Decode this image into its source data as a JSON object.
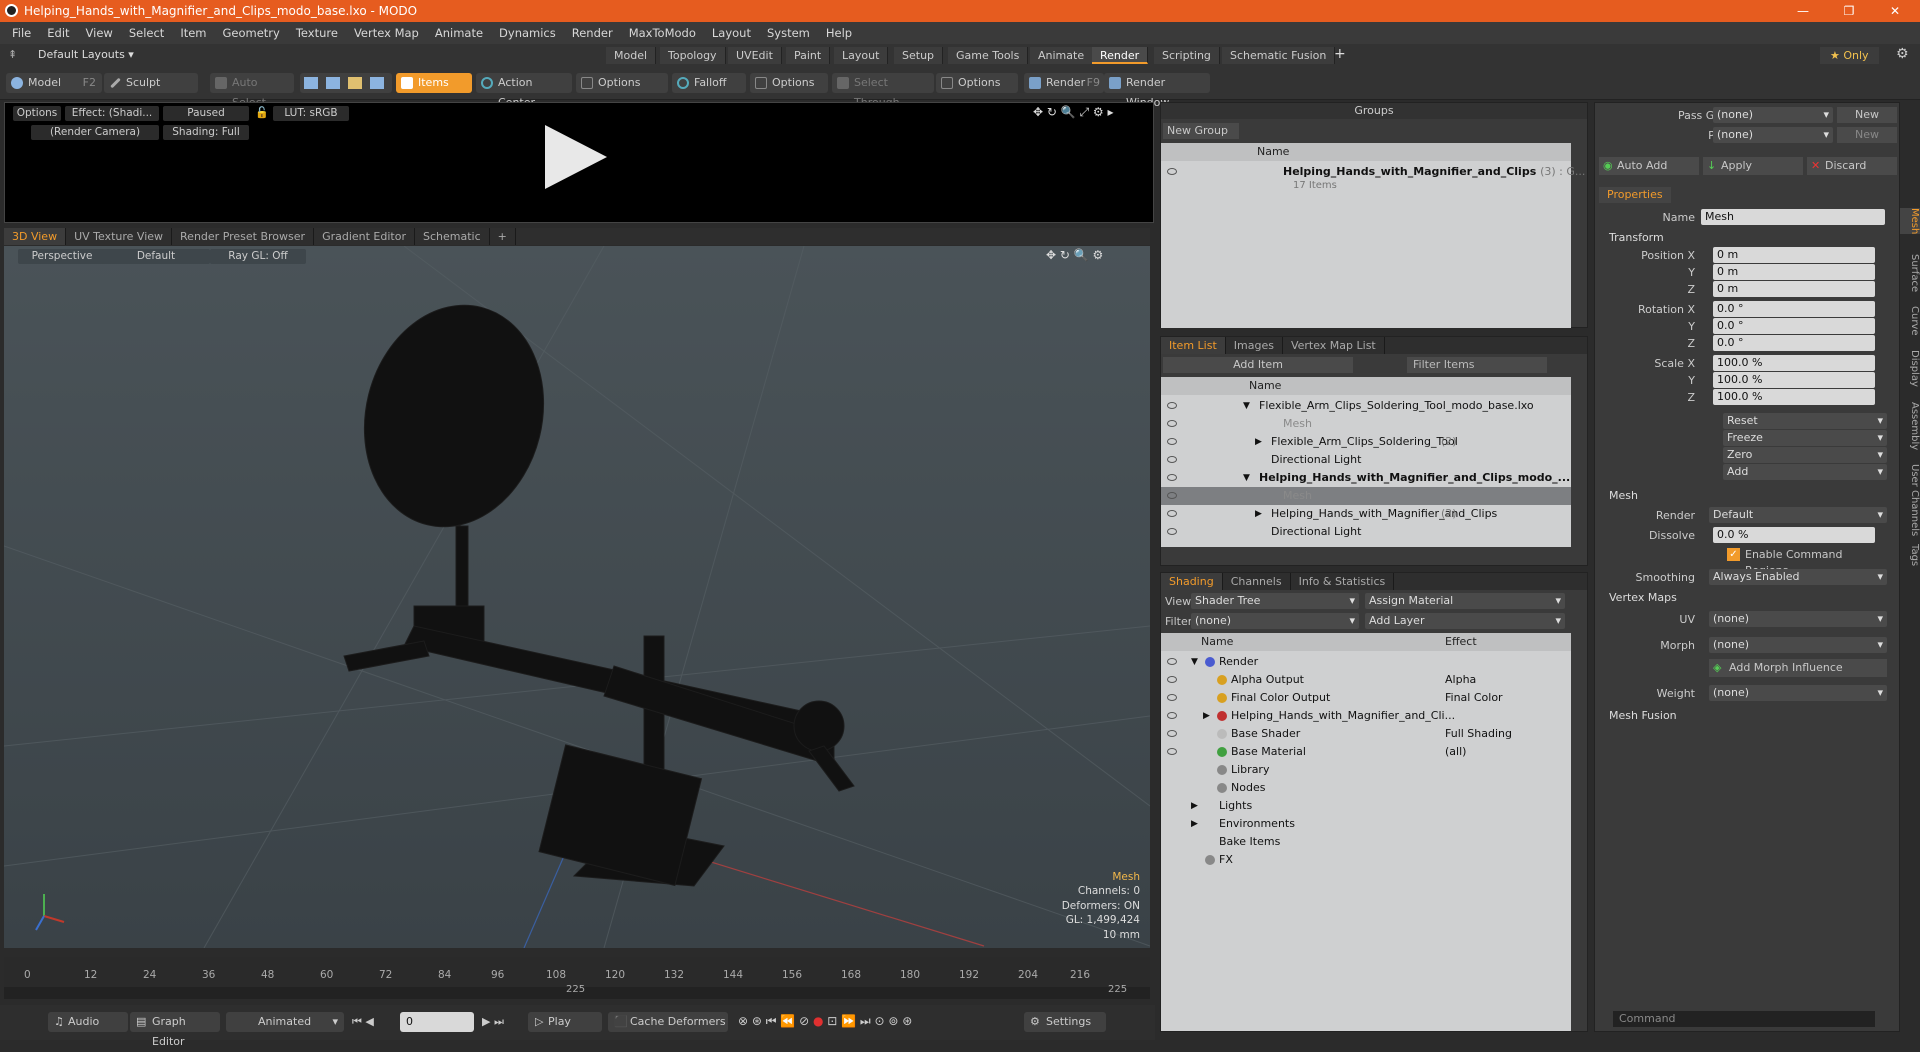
{
  "window": {
    "title": "Helping_Hands_with_Magnifier_and_Clips_modo_base.lxo - MODO",
    "min": "—",
    "max": "❐",
    "close": "✕"
  },
  "menu": [
    "File",
    "Edit",
    "View",
    "Select",
    "Item",
    "Geometry",
    "Texture",
    "Vertex Map",
    "Animate",
    "Dynamics",
    "Render",
    "MaxToModo",
    "Layout",
    "System",
    "Help"
  ],
  "layouts": {
    "default_label": "Default Layouts ▾",
    "tabs": [
      "Model",
      "Topology",
      "UVEdit",
      "Paint",
      "Layout",
      "Setup",
      "Game Tools",
      "Animate",
      "Render",
      "Scripting",
      "Schematic Fusion"
    ],
    "active": "Render",
    "only": "★ Only"
  },
  "toolbar": {
    "model": "Model",
    "model_key": "F2",
    "sculpt": "Sculpt",
    "auto_select": "Auto Select",
    "items": "Items",
    "action_center": "Action Center",
    "options1": "Options",
    "falloff": "Falloff",
    "options2": "Options",
    "select_through": "Select Through",
    "options3": "Options",
    "render": "Render",
    "render_key": "F9",
    "render_window": "Render Window"
  },
  "render_view": {
    "options": "Options",
    "effect": "Effect: (Shadi...",
    "paused": "Paused",
    "lut": "LUT: sRGB",
    "camera": "(Render Camera)",
    "shading": "Shading: Full"
  },
  "view_tabs": [
    "3D View",
    "UV Texture View",
    "Render Preset Browser",
    "Gradient Editor",
    "Schematic"
  ],
  "viewport": {
    "perspective": "Perspective",
    "default": "Default",
    "raygl": "Ray GL: Off",
    "stats_title": "Mesh",
    "channels": "Channels: 0",
    "deformers": "Deformers: ON",
    "gl": "GL: 1,499,424",
    "scale": "10 mm"
  },
  "timeline": {
    "ticks": [
      "0",
      "12",
      "24",
      "36",
      "48",
      "60",
      "72",
      "84",
      "96",
      "108",
      "120",
      "132",
      "144",
      "156",
      "168",
      "180",
      "192",
      "204",
      "216"
    ],
    "mid": "225",
    "end": "225"
  },
  "bottombar": {
    "audio": "Audio",
    "graph_editor": "Graph Editor",
    "animated": "Animated",
    "frame": "0",
    "play": "Play",
    "cache": "Cache Deformers",
    "settings": "Settings"
  },
  "groups": {
    "title": "Groups",
    "new_group": "New Group",
    "col_name": "Name",
    "item_name": "Helping_Hands_with_Magnifier_and_Clips",
    "item_suffix": "(3) : G...",
    "item_count": "17 Items"
  },
  "itemlist": {
    "tabs": [
      "Item List",
      "Images",
      "Vertex Map List"
    ],
    "add_item": "Add Item",
    "filter": "Filter Items",
    "col_name": "Name",
    "rows": [
      {
        "label": "Flexible_Arm_Clips_Soldering_Tool_modo_base.lxo",
        "indent": 0,
        "bold": false,
        "dim": false,
        "sel": false,
        "tri": "▼"
      },
      {
        "label": "Mesh",
        "indent": 2,
        "bold": false,
        "dim": true,
        "sel": false,
        "tri": ""
      },
      {
        "label": "Flexible_Arm_Clips_Soldering_Tool",
        "count": "(2)",
        "indent": 1,
        "bold": false,
        "dim": false,
        "sel": false,
        "tri": "▶"
      },
      {
        "label": "Directional Light",
        "indent": 1,
        "bold": false,
        "dim": false,
        "sel": false,
        "tri": ""
      },
      {
        "label": "Helping_Hands_with_Magnifier_and_Clips_modo_...",
        "indent": 0,
        "bold": true,
        "dim": false,
        "sel": false,
        "tri": "▼"
      },
      {
        "label": "Mesh",
        "indent": 2,
        "bold": false,
        "dim": true,
        "sel": true,
        "tri": ""
      },
      {
        "label": "Helping_Hands_with_Magnifier_and_Clips",
        "count": "(2)",
        "indent": 1,
        "bold": false,
        "dim": false,
        "sel": false,
        "tri": "▶"
      },
      {
        "label": "Directional Light",
        "indent": 1,
        "bold": false,
        "dim": false,
        "sel": false,
        "tri": ""
      }
    ]
  },
  "shading": {
    "tabs": [
      "Shading",
      "Channels",
      "Info & Statistics"
    ],
    "view_label": "View",
    "view_value": "Shader Tree",
    "assign": "Assign Material",
    "filter_label": "Filter",
    "filter_value": "(none)",
    "add_layer": "Add Layer",
    "col_name": "Name",
    "col_effect": "Effect",
    "rows": [
      {
        "label": "Render",
        "effect": "",
        "indent": 0,
        "tri": "▼",
        "color": "#4a5bd0"
      },
      {
        "label": "Alpha Output",
        "effect": "Alpha",
        "indent": 1,
        "tri": "",
        "color": "#d8a020"
      },
      {
        "label": "Final Color Output",
        "effect": "Final Color",
        "indent": 1,
        "tri": "",
        "color": "#d8a020"
      },
      {
        "label": "Helping_Hands_with_Magnifier_and_Cli...",
        "effect": "",
        "indent": 1,
        "tri": "▶",
        "color": "#c03030"
      },
      {
        "label": "Base Shader",
        "effect": "Full Shading",
        "indent": 1,
        "tri": "",
        "color": "#bbbbbb"
      },
      {
        "label": "Base Material",
        "effect": "(all)",
        "indent": 1,
        "tri": "",
        "color": "#40a040"
      },
      {
        "label": "Library",
        "effect": "",
        "indent": 1,
        "tri": "",
        "color": "#888"
      },
      {
        "label": "Nodes",
        "effect": "",
        "indent": 1,
        "tri": "",
        "color": "#888"
      },
      {
        "label": "Lights",
        "effect": "",
        "indent": 0,
        "tri": "▶",
        "color": ""
      },
      {
        "label": "Environments",
        "effect": "",
        "indent": 0,
        "tri": "▶",
        "color": ""
      },
      {
        "label": "Bake Items",
        "effect": "",
        "indent": 0,
        "tri": "",
        "color": ""
      },
      {
        "label": "FX",
        "effect": "",
        "indent": 0,
        "tri": "",
        "color": "#888"
      }
    ]
  },
  "props": {
    "pass_groups_label": "Pass Groups",
    "pass_groups": "(none)",
    "new1": "New",
    "passes_label": "Passes",
    "passes": "(none)",
    "new2": "New",
    "auto_add": "Auto Add",
    "apply": "Apply",
    "discard": "Discard",
    "tab": "Properties",
    "name_label": "Name",
    "name": "Mesh",
    "transform": "Transform",
    "pos_label": "Position X",
    "px": "0 m",
    "py": "0 m",
    "pz": "0 m",
    "rot_label": "Rotation X",
    "rx": "0.0 °",
    "ry": "0.0 °",
    "rz": "0.0 °",
    "scale_label": "Scale X",
    "sx": "100.0 %",
    "sy": "100.0 %",
    "sz": "100.0 %",
    "y": "Y",
    "z": "Z",
    "reset": "Reset",
    "freeze": "Freeze",
    "zero": "Zero",
    "add": "Add",
    "mesh": "Mesh",
    "render_label": "Render",
    "render": "Default",
    "dissolve_label": "Dissolve",
    "dissolve": "0.0 %",
    "ecr": "Enable Command Regions",
    "smoothing_label": "Smoothing",
    "smoothing": "Always Enabled",
    "vertex_maps": "Vertex Maps",
    "uv_label": "UV",
    "uv": "(none)",
    "morph_label": "Morph",
    "morph": "(none)",
    "add_morph": "Add Morph Influence",
    "weight_label": "Weight",
    "weight": "(none)",
    "mesh_fusion": "Mesh Fusion",
    "command": "Command"
  },
  "sidetabs": [
    "Mesh",
    "Surface",
    "Curve",
    "Display",
    "Assembly",
    "User Channels",
    "Tags"
  ]
}
